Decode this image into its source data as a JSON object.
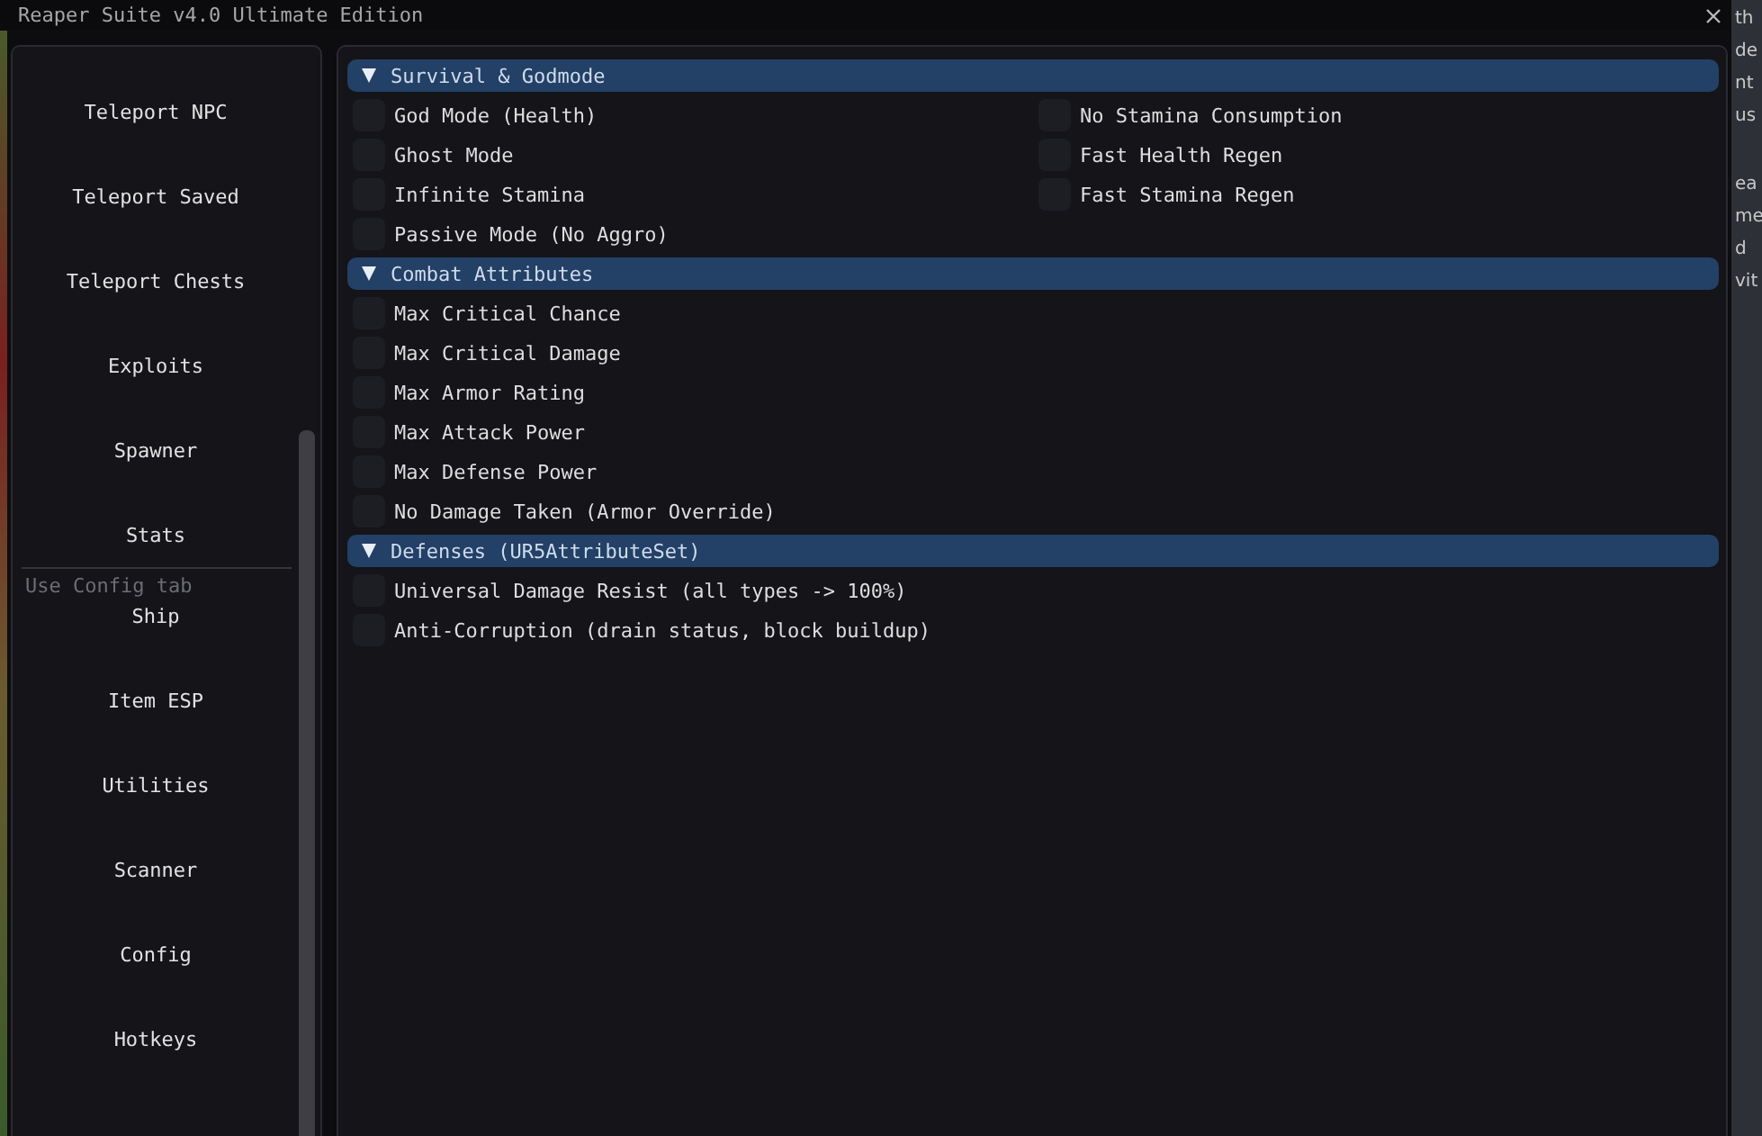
{
  "window": {
    "title": "Reaper Suite v4.0 Ultimate Edition"
  },
  "sidebar": {
    "items": [
      {
        "kind": "tab",
        "label": "Teleport NPC"
      },
      {
        "kind": "tab",
        "label": "Teleport Saved"
      },
      {
        "kind": "tab",
        "label": "Teleport Chests"
      },
      {
        "kind": "tab",
        "label": "Exploits"
      },
      {
        "kind": "tab",
        "label": "Spawner"
      },
      {
        "kind": "tab",
        "label": "Stats"
      },
      {
        "kind": "hint",
        "label": "Use Config tab"
      },
      {
        "kind": "tab",
        "label": "Ship"
      },
      {
        "kind": "tab",
        "label": "Item ESP"
      },
      {
        "kind": "tab",
        "label": "Utilities"
      },
      {
        "kind": "tab",
        "label": "Scanner"
      },
      {
        "kind": "tab",
        "label": "Config"
      },
      {
        "kind": "tab",
        "label": "Hotkeys"
      }
    ]
  },
  "sections": [
    {
      "title": "Survival & Godmode",
      "expanded": true,
      "columns": [
        [
          {
            "label": "God Mode (Health)",
            "checked": false
          },
          {
            "label": "Ghost Mode",
            "checked": false
          },
          {
            "label": "Infinite Stamina",
            "checked": false
          },
          {
            "label": "Passive Mode (No Aggro)",
            "checked": false
          }
        ],
        [
          {
            "label": "No Stamina Consumption",
            "checked": false
          },
          {
            "label": "Fast Health Regen",
            "checked": false
          },
          {
            "label": "Fast Stamina Regen",
            "checked": false
          }
        ]
      ]
    },
    {
      "title": "Combat Attributes",
      "expanded": true,
      "columns": [
        [
          {
            "label": "Max Critical Chance",
            "checked": false
          },
          {
            "label": "Max Critical Damage",
            "checked": false
          },
          {
            "label": "Max Armor Rating",
            "checked": false
          },
          {
            "label": "Max Attack Power",
            "checked": false
          },
          {
            "label": "Max Defense Power",
            "checked": false
          },
          {
            "label": "No Damage Taken (Armor Override)",
            "checked": false
          }
        ]
      ]
    },
    {
      "title": "Defenses (UR5AttributeSet)",
      "expanded": true,
      "columns": [
        [
          {
            "label": "Universal Damage Resist (all types -> 100%)",
            "checked": false
          },
          {
            "label": "Anti-Corruption (drain status, block buildup)",
            "checked": false
          }
        ]
      ]
    }
  ],
  "background_window": {
    "lines": [
      "th",
      "de",
      "nt",
      "us",
      "ea",
      "me",
      "d",
      "vit"
    ]
  }
}
